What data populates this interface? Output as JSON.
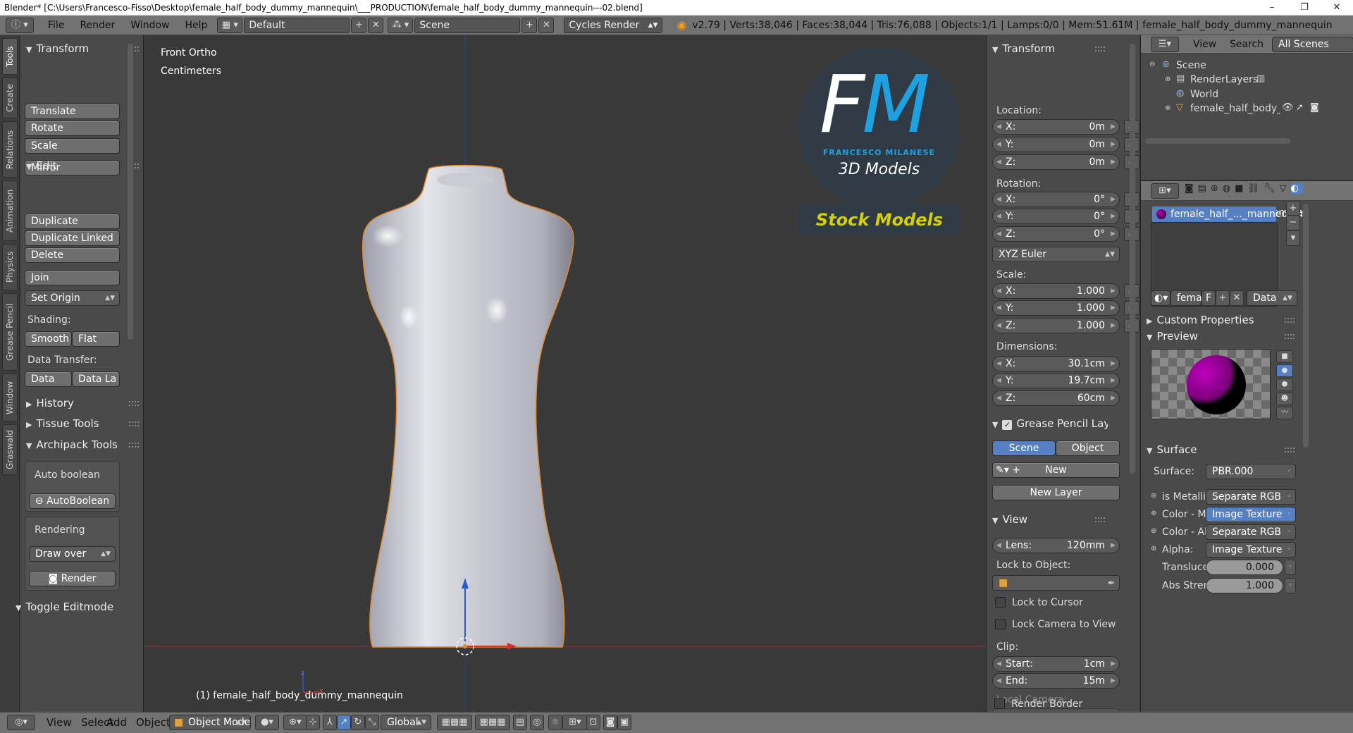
{
  "window": {
    "title": "Blender* [C:\\Users\\Francesco-Fisso\\Desktop\\female_half_body_dummy_mannequin\\___PRODUCTION\\female_half_body_dummy_mannequin---02.blend]",
    "minimize": "–",
    "maximize": "❐",
    "close": "✕"
  },
  "info_header": {
    "menus": [
      "File",
      "Render",
      "Window",
      "Help"
    ],
    "layout": "Default",
    "scene": "Scene",
    "engine": "Cycles Render",
    "stats": "v2.79 | Verts:38,046 | Faces:38,044 | Tris:76,088 | Objects:1/1 | Lamps:0/0 | Mem:51.61M | female_half_body_dummy_mannequin"
  },
  "left_tabs": [
    "Tools",
    "Create",
    "Relations",
    "Animation",
    "Physics",
    "Grease Pencil",
    "Window",
    "Graswald"
  ],
  "tool_shelf": {
    "transform": {
      "title": "Transform",
      "translate": "Translate",
      "rotate": "Rotate",
      "scale": "Scale",
      "mirror": "Mirror"
    },
    "edit": {
      "title": "Edit",
      "duplicate": "Duplicate",
      "duplicate_linked": "Duplicate Linked",
      "delete": "Delete",
      "join": "Join",
      "set_origin": "Set Origin",
      "shading_label": "Shading:",
      "smooth": "Smooth",
      "flat": "Flat",
      "data_transfer_label": "Data Transfer:",
      "data": "Data",
      "data_layers": "Data La"
    },
    "history": "History",
    "tissue_tools": "Tissue Tools",
    "archipack": {
      "title": "Archipack Tools",
      "auto_boolean_label": "Auto boolean",
      "auto_boolean_btn": "AutoBoolean",
      "rendering_label": "Rendering",
      "draw_over": "Draw over",
      "render": "Render"
    },
    "toggle_editmode": "Toggle Editmode"
  },
  "viewport": {
    "view_name": "Front Ortho",
    "units": "Centimeters",
    "object_label": "(1) female_half_body_dummy_mannequin",
    "logo": {
      "letters": "FM",
      "brand": "FRANCESCO MILANESE",
      "tagline": "3D Models",
      "stock": "Stock Models",
      "ring_color": "#2f3a44",
      "accent": "#1da1e0",
      "stock_color": "#d7d000"
    }
  },
  "n_panel": {
    "transform_title": "Transform",
    "location_label": "Location:",
    "location": [
      {
        "k": "X:",
        "v": "0m"
      },
      {
        "k": "Y:",
        "v": "0m"
      },
      {
        "k": "Z:",
        "v": "0m"
      }
    ],
    "rotation_label": "Rotation:",
    "rotation": [
      {
        "k": "X:",
        "v": "0°"
      },
      {
        "k": "Y:",
        "v": "0°"
      },
      {
        "k": "Z:",
        "v": "0°"
      }
    ],
    "rotation_mode": "XYZ Euler",
    "scale_label": "Scale:",
    "scale": [
      {
        "k": "X:",
        "v": "1.000"
      },
      {
        "k": "Y:",
        "v": "1.000"
      },
      {
        "k": "Z:",
        "v": "1.000"
      }
    ],
    "dimensions_label": "Dimensions:",
    "dimensions": [
      {
        "k": "X:",
        "v": "30.1cm"
      },
      {
        "k": "Y:",
        "v": "19.7cm"
      },
      {
        "k": "Z:",
        "v": "60cm"
      }
    ],
    "grease_pencil": {
      "title": "Grease Pencil Layer",
      "scene": "Scene",
      "object": "Object",
      "new": "New",
      "new_layer": "New Layer"
    },
    "view": {
      "title": "View",
      "lens_key": "Lens:",
      "lens_val": "120mm",
      "lock_to_object": "Lock to Object:",
      "lock_to_cursor": "Lock to Cursor",
      "lock_camera": "Lock Camera to View",
      "clip": "Clip:",
      "start_key": "Start:",
      "start_val": "1cm",
      "end_key": "End:",
      "end_val": "15m",
      "local_camera": "Local Camera:",
      "render_border": "Render Border"
    }
  },
  "outliner": {
    "view": "View",
    "search": "Search",
    "filter": "All Scenes",
    "items": [
      "Scene",
      "RenderLayers",
      "World",
      "female_half_body_dum"
    ]
  },
  "properties": {
    "breadcrumb": [
      "female",
      "female"
    ],
    "material_slot": "female_half_..._mannequin",
    "material_name": "femal",
    "fake_user": "F",
    "link": "Data",
    "custom_properties": "Custom Properties",
    "preview": "Preview",
    "surface_title": "Surface",
    "surface_key": "Surface:",
    "surface_val": "PBR.000",
    "inputs": [
      {
        "k": "is Metallic",
        "v": "Separate RGB"
      },
      {
        "k": "Color - Ma",
        "v": "Image Texture"
      },
      {
        "k": "Color - Ab",
        "v": "Separate RGB"
      },
      {
        "k": "Alpha:",
        "v": "Image Texture"
      }
    ],
    "translucency_key": "Transluce",
    "translucency_val": "0.000",
    "abs_strength_key": "Abs Stren",
    "abs_strength_val": "1.000"
  },
  "bottom_bar": {
    "menus": [
      "View",
      "Select",
      "Add",
      "Object"
    ],
    "mode": "Object Mode",
    "orientation": "Global"
  }
}
